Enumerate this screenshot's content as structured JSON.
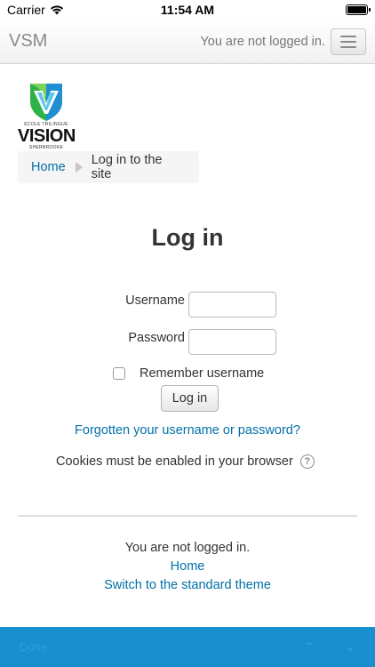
{
  "status": {
    "carrier": "Carrier",
    "time": "11:54 AM"
  },
  "navbar": {
    "brand": "VSM",
    "login_status": "You are not logged in."
  },
  "logo": {
    "line1": "ÉCOLE TRILINGUE",
    "word": "VISION",
    "line2": "SHERBROOKE",
    "colors": [
      "#2bb34a",
      "#1e8fd1",
      "#5ec7ea"
    ]
  },
  "breadcrumb": {
    "home": "Home",
    "current": "Log in to the site"
  },
  "page": {
    "title": "Log in"
  },
  "form": {
    "username_label": "Username",
    "username_value": "",
    "password_label": "Password",
    "password_value": "",
    "remember_label": "Remember username",
    "login_button": "Log in",
    "forgot_link": "Forgotten your username or password?",
    "cookies_text": "Cookies must be enabled in your browser",
    "help_icon": "?"
  },
  "footer": {
    "status": "You are not logged in.",
    "home_link": "Home",
    "theme_link": "Switch to the standard theme"
  },
  "bottombar": {
    "left_label": "Done",
    "color": "#1a8fcf"
  }
}
